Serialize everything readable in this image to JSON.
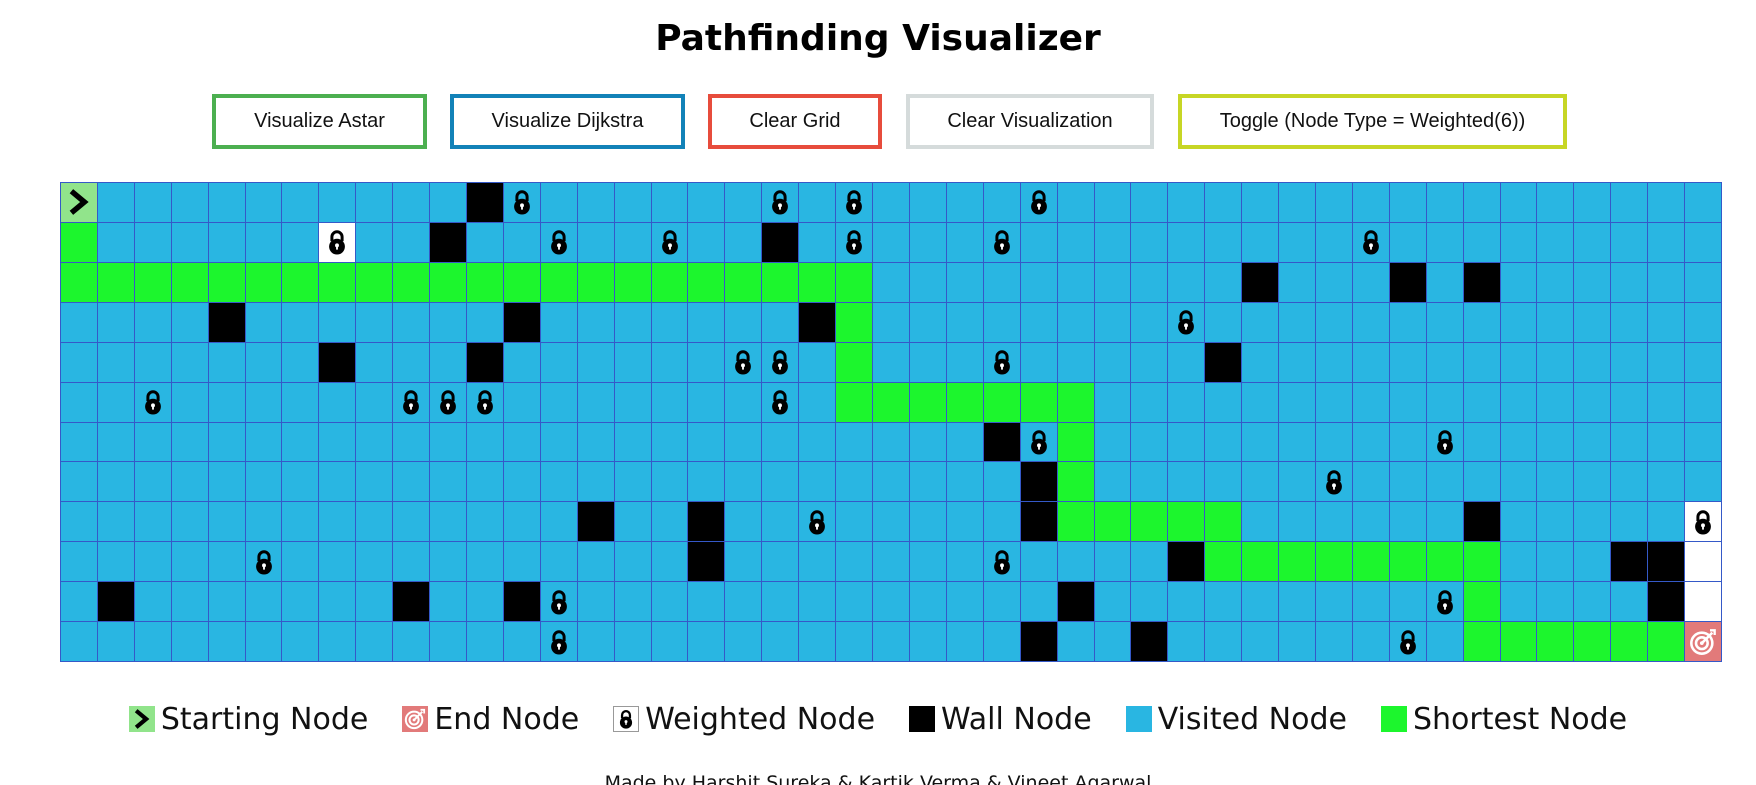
{
  "header": {
    "title": "Pathfinding Visualizer"
  },
  "toolbar": {
    "buttons": [
      {
        "label": "Visualize Astar",
        "color": "#4caf50"
      },
      {
        "label": "Visualize Dijkstra",
        "color": "#1282b8"
      },
      {
        "label": "Clear Grid",
        "color": "#e74c3c"
      },
      {
        "label": "Clear Visualization",
        "color": "#d5dbdb"
      },
      {
        "label": "Toggle (Node Type = Weighted(6))",
        "color": "#c7d625"
      }
    ]
  },
  "grid": {
    "rows": 12,
    "cols": 45,
    "colors": {
      "visited": "#29b6e2",
      "shortest": "#1cf62d",
      "wall": "#000000",
      "start": "#91e48b",
      "end": "#e27a7a",
      "unvisited": "#ffffff",
      "gridline": "#3559c8"
    },
    "start": [
      0,
      0
    ],
    "end": [
      11,
      44
    ],
    "walls": [
      [
        0,
        11
      ],
      [
        1,
        10
      ],
      [
        1,
        19
      ],
      [
        2,
        32
      ],
      [
        2,
        36
      ],
      [
        2,
        38
      ],
      [
        3,
        4
      ],
      [
        3,
        12
      ],
      [
        3,
        20
      ],
      [
        4,
        7
      ],
      [
        4,
        11
      ],
      [
        4,
        31
      ],
      [
        6,
        25
      ],
      [
        7,
        26
      ],
      [
        8,
        14
      ],
      [
        8,
        17
      ],
      [
        8,
        26
      ],
      [
        8,
        38
      ],
      [
        9,
        17
      ],
      [
        9,
        30
      ],
      [
        9,
        42
      ],
      [
        9,
        43
      ],
      [
        10,
        1
      ],
      [
        10,
        9
      ],
      [
        10,
        12
      ],
      [
        10,
        27
      ],
      [
        10,
        43
      ],
      [
        11,
        26
      ],
      [
        11,
        29
      ]
    ],
    "weights": [
      [
        0,
        12
      ],
      [
        0,
        19
      ],
      [
        0,
        21
      ],
      [
        0,
        26
      ],
      [
        1,
        7
      ],
      [
        1,
        13
      ],
      [
        1,
        16
      ],
      [
        1,
        21
      ],
      [
        1,
        25
      ],
      [
        1,
        35
      ],
      [
        3,
        30
      ],
      [
        4,
        18
      ],
      [
        4,
        19
      ],
      [
        4,
        25
      ],
      [
        5,
        2
      ],
      [
        5,
        9
      ],
      [
        5,
        10
      ],
      [
        5,
        11
      ],
      [
        5,
        19
      ],
      [
        6,
        26
      ],
      [
        6,
        37
      ],
      [
        7,
        34
      ],
      [
        8,
        20
      ],
      [
        8,
        44
      ],
      [
        9,
        5
      ],
      [
        9,
        25
      ],
      [
        10,
        13
      ],
      [
        10,
        37
      ],
      [
        11,
        13
      ],
      [
        11,
        36
      ]
    ],
    "unvisited": [
      [
        1,
        7
      ],
      [
        8,
        44
      ],
      [
        9,
        44
      ],
      [
        10,
        44
      ]
    ],
    "shortest_path": [
      [
        1,
        0
      ],
      [
        2,
        0
      ],
      [
        2,
        1
      ],
      [
        2,
        2
      ],
      [
        2,
        3
      ],
      [
        2,
        4
      ],
      [
        2,
        5
      ],
      [
        2,
        6
      ],
      [
        2,
        7
      ],
      [
        2,
        8
      ],
      [
        2,
        9
      ],
      [
        2,
        10
      ],
      [
        2,
        11
      ],
      [
        2,
        12
      ],
      [
        2,
        13
      ],
      [
        2,
        14
      ],
      [
        2,
        15
      ],
      [
        2,
        16
      ],
      [
        2,
        17
      ],
      [
        2,
        18
      ],
      [
        2,
        19
      ],
      [
        2,
        20
      ],
      [
        2,
        21
      ],
      [
        3,
        21
      ],
      [
        4,
        21
      ],
      [
        5,
        21
      ],
      [
        5,
        22
      ],
      [
        5,
        23
      ],
      [
        5,
        24
      ],
      [
        5,
        25
      ],
      [
        5,
        26
      ],
      [
        5,
        27
      ],
      [
        6,
        27
      ],
      [
        7,
        27
      ],
      [
        8,
        27
      ],
      [
        8,
        28
      ],
      [
        8,
        29
      ],
      [
        8,
        30
      ],
      [
        8,
        31
      ],
      [
        9,
        31
      ],
      [
        9,
        32
      ],
      [
        9,
        33
      ],
      [
        9,
        34
      ],
      [
        9,
        35
      ],
      [
        9,
        36
      ],
      [
        9,
        37
      ],
      [
        9,
        38
      ],
      [
        10,
        38
      ],
      [
        11,
        38
      ],
      [
        11,
        39
      ],
      [
        11,
        40
      ],
      [
        11,
        41
      ],
      [
        11,
        42
      ],
      [
        11,
        43
      ]
    ]
  },
  "legend": {
    "items": [
      {
        "label": "Starting Node",
        "icon": "chevron-right-icon",
        "color": "#91e48b"
      },
      {
        "label": "End Node",
        "icon": "target-icon",
        "color": "#e27a7a"
      },
      {
        "label": "Weighted Node",
        "icon": "lock-icon",
        "color": "#ffffff"
      },
      {
        "label": "Wall Node",
        "icon": "",
        "color": "#000000"
      },
      {
        "label": "Visited Node",
        "icon": "",
        "color": "#29b6e2"
      },
      {
        "label": "Shortest Node",
        "icon": "",
        "color": "#1cf62d"
      }
    ]
  },
  "footer": {
    "credits": "Made by Harshit Sureka & Kartik Verma & Vineet Agarwal"
  }
}
